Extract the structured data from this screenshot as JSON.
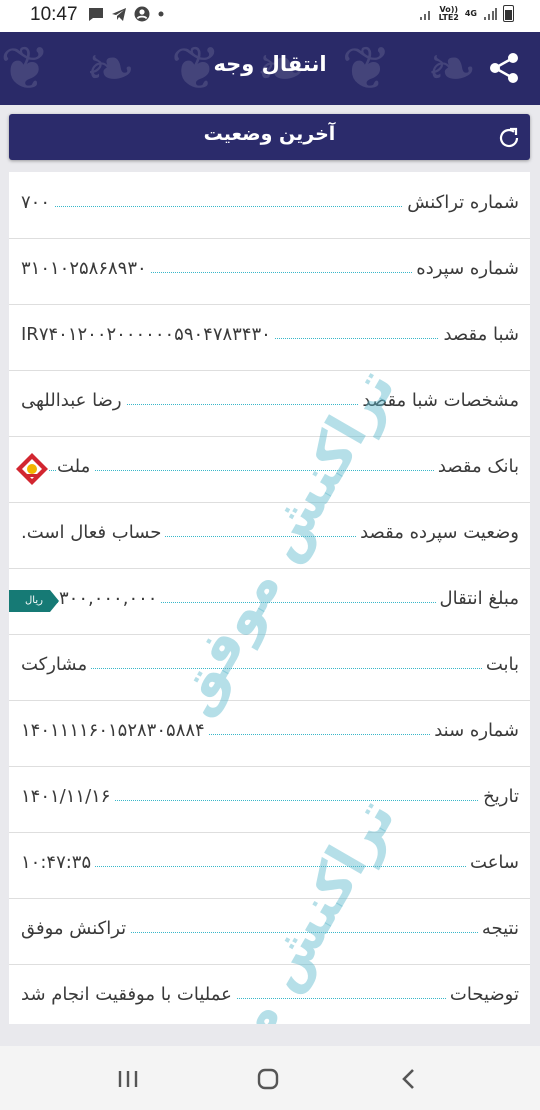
{
  "status_bar": {
    "time": "10:47",
    "icons": [
      "message-icon",
      "telegram-icon",
      "account-icon",
      "dot-icon"
    ],
    "volte": "Vo))",
    "lte": "LTE2",
    "network_4g": "4G"
  },
  "header": {
    "title": "انتقال وجه",
    "share_icon": "share-icon",
    "background_color": "#2a2a68"
  },
  "status_card": {
    "label": "آخرین وضعیت",
    "refresh_icon": "refresh-icon"
  },
  "details": {
    "rows": [
      {
        "label": "شماره تراکنش",
        "value": "۷۰۰"
      },
      {
        "label": "شماره سپرده",
        "value": "۳۱۰۱۰۲۵۸۶۸۹۳۰"
      },
      {
        "label": "شبا مقصد",
        "value": "IR۷۴۰۱۲۰۰۲۰۰۰۰۰۰۵۹۰۴۷۸۳۴۳۰"
      },
      {
        "label": "مشخصات شبا مقصد",
        "value": "رضا عبداللهی"
      },
      {
        "label": "بانک مقصد",
        "value": "ملت"
      },
      {
        "label": "وضعیت سپرده مقصد",
        "value": "حساب فعال است."
      },
      {
        "label": "مبلغ انتقال",
        "value": "۳۰۰,۰۰۰,۰۰۰",
        "unit": "ریال"
      },
      {
        "label": "بابت",
        "value": "مشارکت"
      },
      {
        "label": "شماره سند",
        "value": "۱۴۰۱۱۱۱۶۰۱۵۲۸۳۰۵۸۸۴"
      },
      {
        "label": "تاریخ",
        "value": "۱۴۰۱/۱۱/۱۶"
      },
      {
        "label": "ساعت",
        "value": "۱۰:۴۷:۳۵"
      },
      {
        "label": "نتیجه",
        "value": "تراکنش موفق"
      },
      {
        "label": "توضیحات",
        "value": "عملیات با موفقیت انجام شد"
      }
    ],
    "watermark": "تراکنش موفق",
    "accent_color": "#38b7c9"
  },
  "nav_bar": {
    "items": [
      "recent-apps-icon",
      "home-icon",
      "back-icon"
    ]
  }
}
